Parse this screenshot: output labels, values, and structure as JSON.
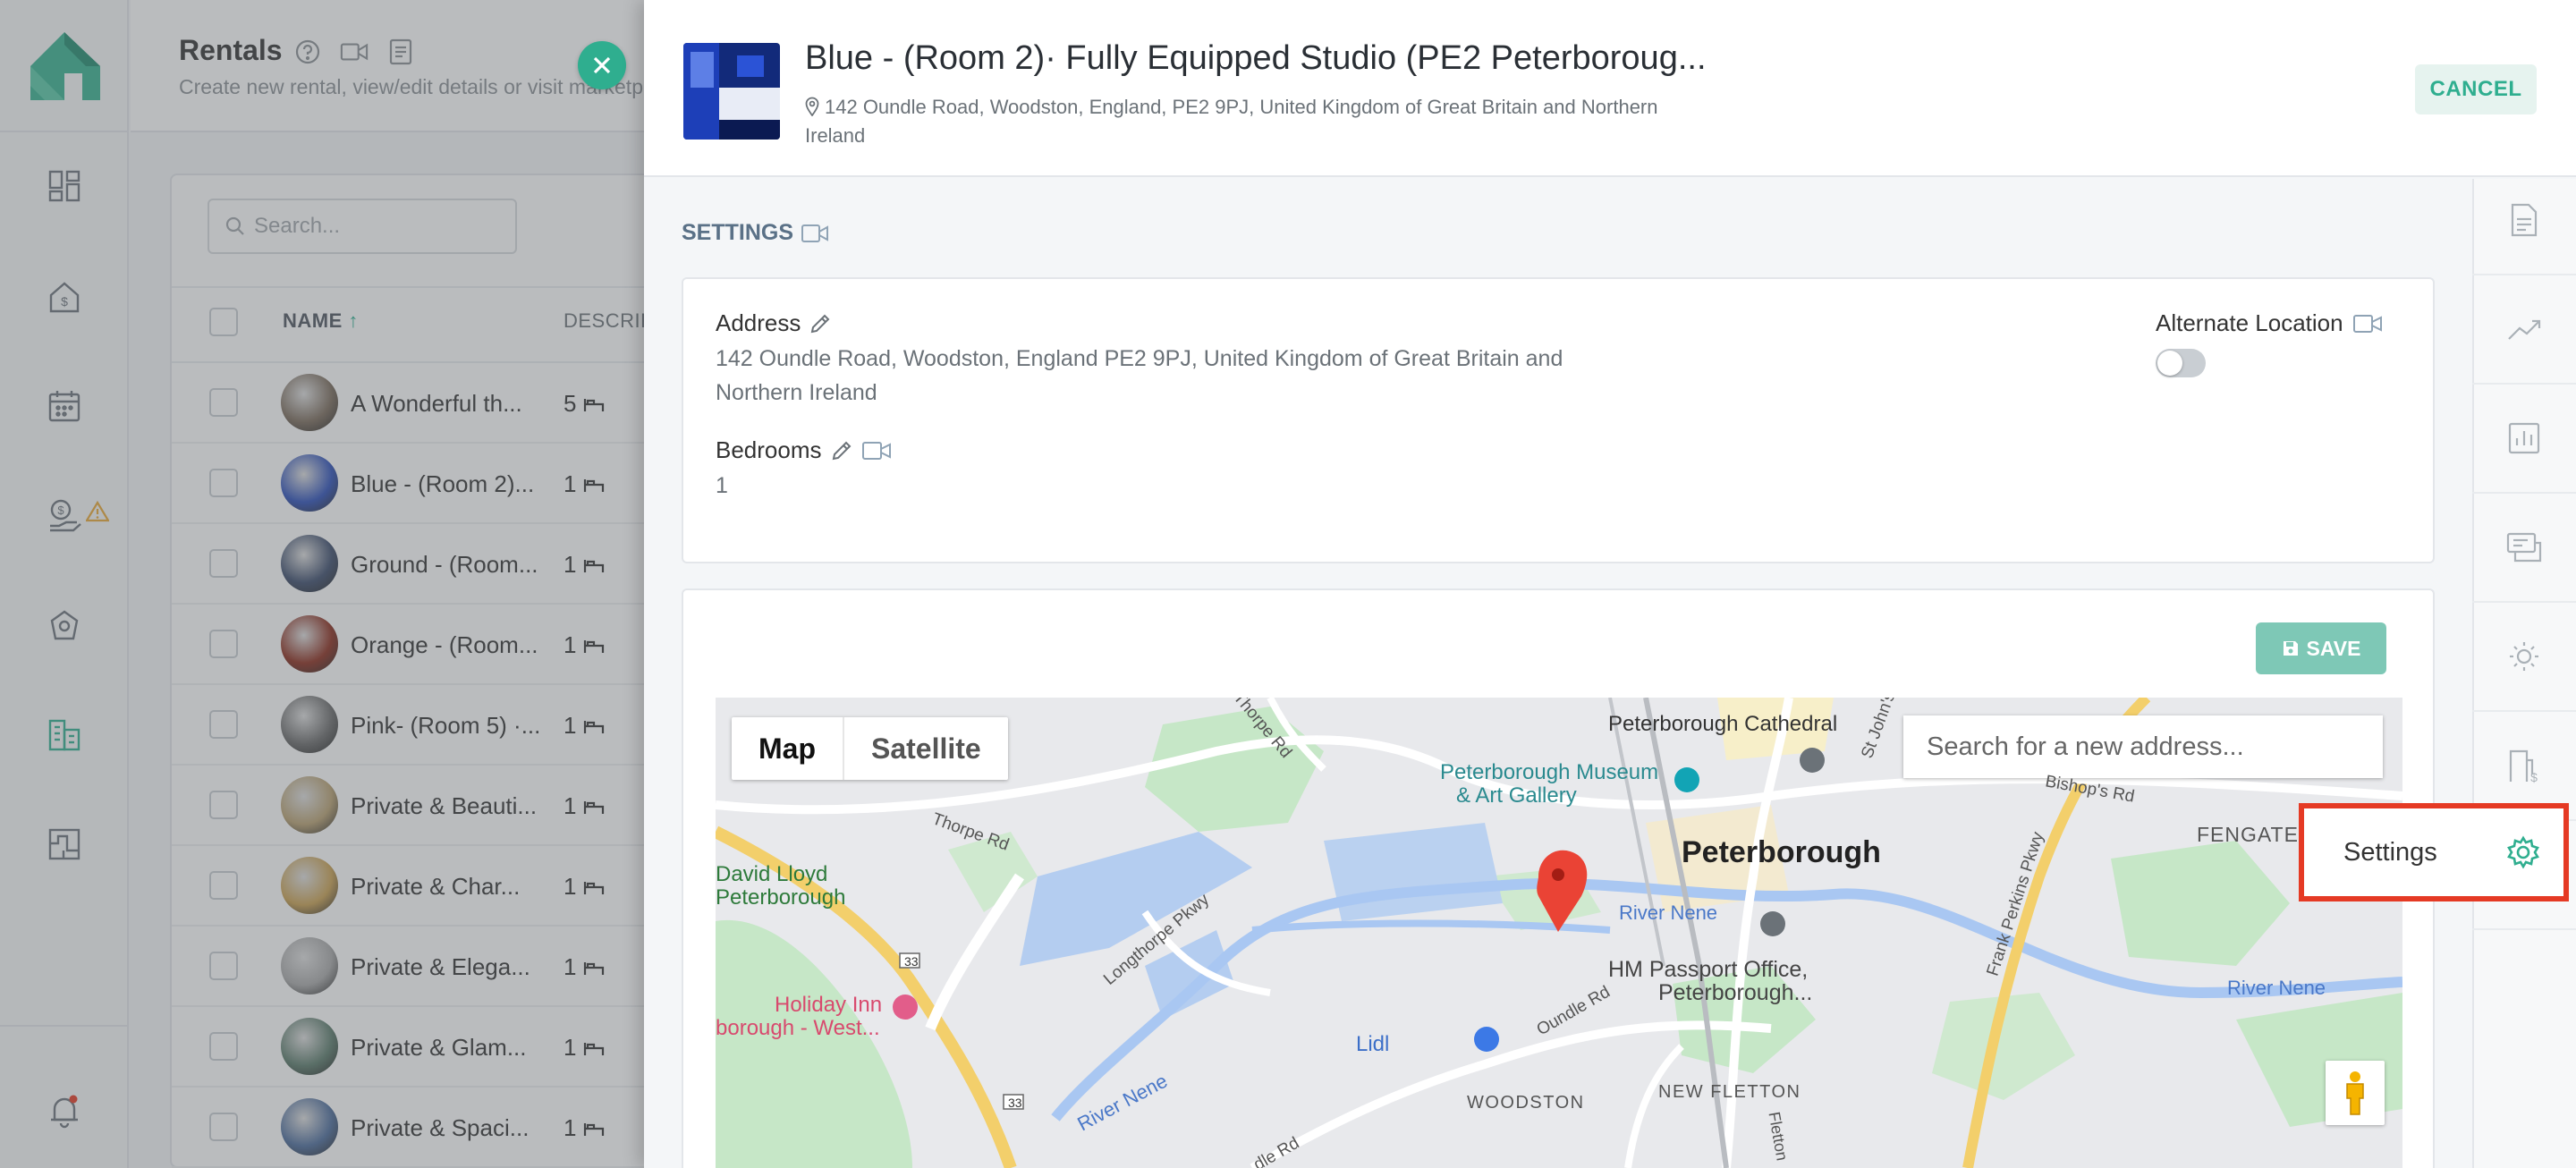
{
  "nav": {
    "items": [
      "dashboard-icon",
      "pricing-icon",
      "calendar-icon",
      "finance-icon",
      "services-icon",
      "rentals-icon",
      "reports-icon"
    ],
    "bell": "bell-icon"
  },
  "page": {
    "title": "Rentals",
    "subtitle": "Create new rental, view/edit details or visit marketplace",
    "search_placeholder": "Search...",
    "columns": {
      "name": "NAME",
      "description": "DESCRIP"
    }
  },
  "rentals": [
    {
      "name": "A Wonderful th...",
      "beds": "5"
    },
    {
      "name": "Blue - (Room 2)...",
      "beds": "1"
    },
    {
      "name": "Ground - (Room...",
      "beds": "1"
    },
    {
      "name": "Orange - (Room...",
      "beds": "1"
    },
    {
      "name": "Pink- (Room 5) ·...",
      "beds": "1"
    },
    {
      "name": "Private & Beauti...",
      "beds": "1"
    },
    {
      "name": "Private & Char...",
      "beds": "1"
    },
    {
      "name": "Private & Elega...",
      "beds": "1"
    },
    {
      "name": "Private & Glam...",
      "beds": "1"
    },
    {
      "name": "Private & Spaci...",
      "beds": "1"
    }
  ],
  "drawer": {
    "title": "Blue - (Room 2)· Fully Equipped Studio (PE2 Peterboroug...",
    "address_line": "142 Oundle Road, Woodston, England, PE2 9PJ, United Kingdom of Great Britain and Northern Ireland",
    "cancel_label": "CANCEL",
    "section_title": "SETTINGS",
    "address_label": "Address",
    "address_value": "142 Oundle Road, Woodston, England PE2 9PJ, United Kingdom of Great Britain and Northern Ireland",
    "alternate_location_label": "Alternate Location",
    "alternate_location_on": false,
    "bedrooms_label": "Bedrooms",
    "bedrooms_value": "1",
    "save_label": "SAVE"
  },
  "map": {
    "type_map": "Map",
    "type_satellite": "Satellite",
    "search_placeholder": "Search for a new address...",
    "labels": {
      "cathedral": "Peterborough Cathedral",
      "museum1": "Peterborough Museum",
      "museum2": "& Art Gallery",
      "city": "Peterborough",
      "fengate": "FENGATE",
      "river1": "River Nene",
      "river2": "River Nene",
      "river3": "River Nene",
      "passport1": "HM Passport Office,",
      "passport2": "Peterborough...",
      "david1": "David Lloyd",
      "david2": "Peterborough",
      "holiday1": "Holiday Inn",
      "holiday2": "borough - West...",
      "lidl": "Lidl",
      "woodston": "WOODSTON",
      "newfletton": "NEW FLETTON",
      "thorpe1": "Thorpe Rd",
      "thorpe2": "Thorpe Rd",
      "longthorpe": "Longthorpe Pkwy",
      "oundle": "Oundle Rd",
      "oundle2": "dle Rd",
      "frank": "Frank Perkins Pkwy",
      "bishops": "Bishop's Rd",
      "stjohns": "St John's",
      "r33a": "33",
      "r33b": "33",
      "fletton": "Fletton"
    }
  },
  "rail": [
    "document-icon",
    "trend-icon",
    "chart-icon",
    "ticket-icon",
    "sun-icon",
    "fee-icon",
    "channels-icon"
  ],
  "settings_popup": {
    "label": "Settings",
    "icon": "gear-icon",
    "highlight": "#e53a24"
  },
  "colors": {
    "accent": "#2fae8f",
    "save": "#7ec8b6",
    "highlight": "#e53a24",
    "pin": "#ea4335"
  }
}
